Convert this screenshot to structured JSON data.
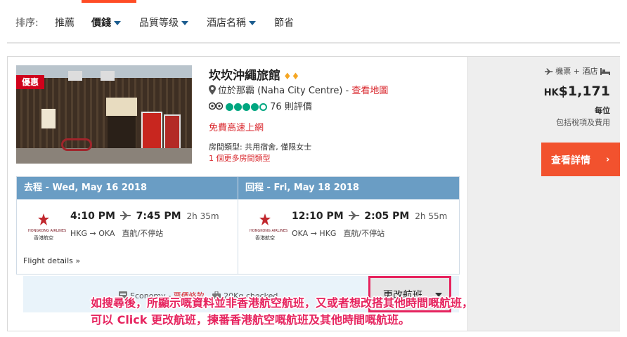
{
  "sort": {
    "label": "排序:",
    "items": [
      {
        "label": "推薦"
      },
      {
        "label": "價錢"
      },
      {
        "label": "品質等级"
      },
      {
        "label": "酒店名稱"
      },
      {
        "label": "節省"
      }
    ]
  },
  "hotel": {
    "badge": "優惠",
    "name": "坎坎沖繩旅館",
    "diamonds": "♦♦",
    "location": "位於那霸 (Naha City Centre)",
    "map_link": "查看地圖",
    "review_count": "76 則評價",
    "rating_bubbles": 4,
    "wifi": "免費高速上網",
    "room_type": "房間類型: 共用宿舍, 僅限女士",
    "more_rooms": "1 個更多房間類型"
  },
  "flights": {
    "outbound": {
      "header": "去程 - Wed, May 16 2018",
      "depart": "4:10 PM",
      "arrive": "7:45 PM",
      "duration": "2h 35m",
      "from": "HKG",
      "to": "OKA",
      "stops": "直航/不停站",
      "airline_en": "HONGKONG AIRLINES",
      "airline_zh": "香港航空"
    },
    "return": {
      "header": "回程 - Fri, May 18 2018",
      "depart": "12:10 PM",
      "arrive": "2:05 PM",
      "duration": "2h 55m",
      "from": "OKA",
      "to": "HKG",
      "stops": "直航/不停站",
      "airline_en": "HONGKONG AIRLINES",
      "airline_zh": "香港航空"
    },
    "details_label": "Flight details",
    "cabin": "Economy",
    "fare_link": "票價條款",
    "baggage": "20Kg checked",
    "change_label": "更改航班"
  },
  "annotation": {
    "line1": "如搜尋後，所顯示嘅資料並非香港航空航班，又或者想改搭其他時間嘅航班，",
    "line2": "可以 Click 更改航班，揀番香港航空嘅航班及其他時間嘅航班。"
  },
  "pricing": {
    "package": "機票 + 酒店",
    "currency": "HK",
    "amount": "$1,171",
    "per": "每位",
    "includes": "包括稅項及費用",
    "details_button": "查看詳情",
    "chevron": "›"
  },
  "colors": {
    "accent": "#ff4c25",
    "red_link": "#d9262c",
    "leg_header": "#6a9dc4",
    "annotation": "#e6245f",
    "details_button": "#f2522e",
    "tripadvisor": "#00a680"
  }
}
